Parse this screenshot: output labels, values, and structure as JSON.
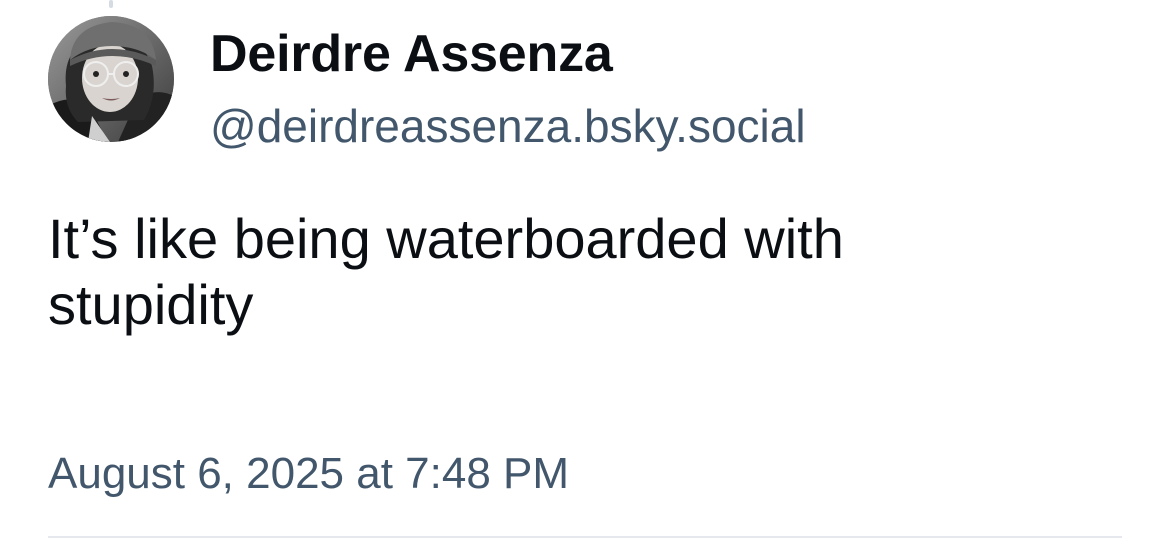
{
  "post": {
    "author": {
      "display_name": "Deirdre Assenza",
      "handle": "@deirdreassenza.bsky.social",
      "avatar_icon": "user-avatar-photo"
    },
    "text": "It’s like being waterboarded with stupidity",
    "timestamp": "August 6, 2025 at 7:48 PM"
  },
  "colors": {
    "primary_text": "#0b0f14",
    "secondary_text": "#42576c",
    "divider": "#e5e8ec",
    "thread_line": "#d5dbe2"
  }
}
